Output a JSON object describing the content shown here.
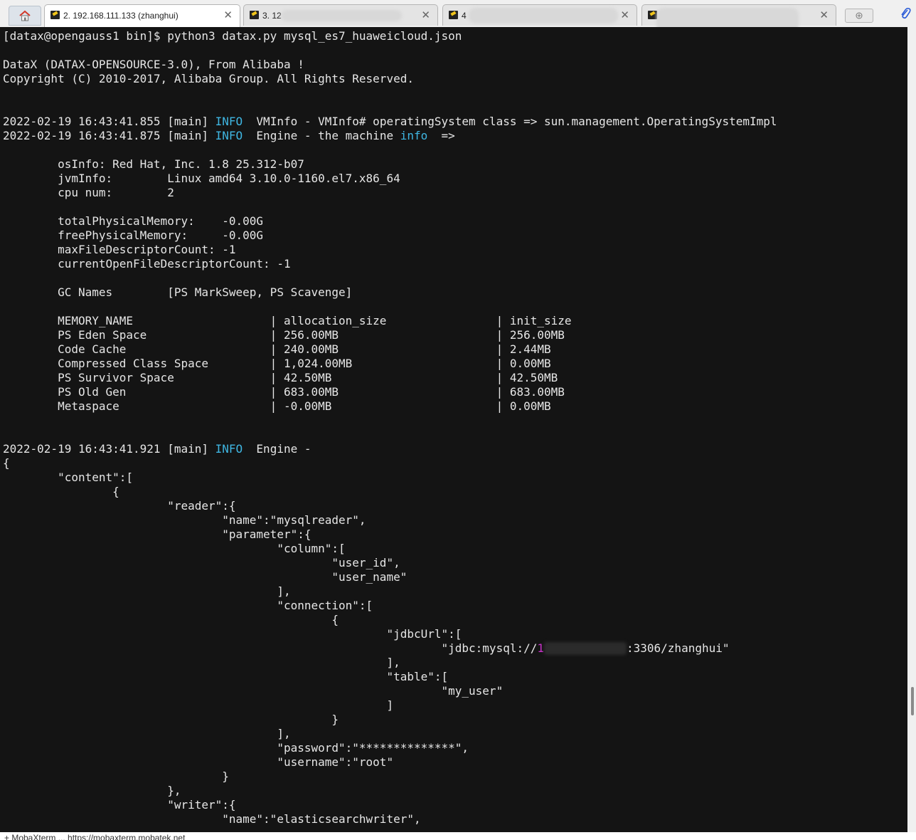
{
  "tabs": [
    {
      "label": "2. 192.168.111.133 (zhanghui)",
      "active": true
    },
    {
      "label": "3. 12",
      "active": false
    },
    {
      "label": "4",
      "active": false
    },
    {
      "label": "",
      "active": false
    }
  ],
  "terminal": {
    "lines": [
      [
        {
          "t": "[datax@opengauss1 bin]$ python3 datax.py mysql_es7_huaweicloud.json"
        }
      ],
      [],
      [
        {
          "t": "DataX (DATAX-OPENSOURCE-3.0), From Alibaba !"
        }
      ],
      [
        {
          "t": "Copyright (C) 2010-2017, Alibaba Group. All Rights Reserved."
        }
      ],
      [],
      [],
      [
        {
          "t": "2022-02-19 16:43:41.855 [main] "
        },
        {
          "t": "INFO",
          "c": "info"
        },
        {
          "t": "  VMInfo - VMInfo# operatingSystem class => sun.management.OperatingSystemImpl"
        }
      ],
      [
        {
          "t": "2022-02-19 16:43:41.875 [main] "
        },
        {
          "t": "INFO",
          "c": "info"
        },
        {
          "t": "  Engine - the machine "
        },
        {
          "t": "info",
          "c": "info"
        },
        {
          "t": "  =>"
        }
      ],
      [],
      [
        {
          "t": "        osInfo: Red Hat, Inc. 1.8 25.312-b07"
        }
      ],
      [
        {
          "t": "        jvmInfo:        Linux amd64 3.10.0-1160.el7.x86_64"
        }
      ],
      [
        {
          "t": "        cpu num:        2"
        }
      ],
      [],
      [
        {
          "t": "        totalPhysicalMemory:    -0.00G"
        }
      ],
      [
        {
          "t": "        freePhysicalMemory:     -0.00G"
        }
      ],
      [
        {
          "t": "        maxFileDescriptorCount: -1"
        }
      ],
      [
        {
          "t": "        currentOpenFileDescriptorCount: -1"
        }
      ],
      [],
      [
        {
          "t": "        GC Names        [PS MarkSweep, PS Scavenge]"
        }
      ],
      [],
      [
        {
          "t": "        MEMORY_NAME                    | allocation_size                | init_size"
        }
      ],
      [
        {
          "t": "        PS Eden Space                  | 256.00MB                       | 256.00MB"
        }
      ],
      [
        {
          "t": "        Code Cache                     | 240.00MB                       | 2.44MB"
        }
      ],
      [
        {
          "t": "        Compressed Class Space         | 1,024.00MB                     | 0.00MB"
        }
      ],
      [
        {
          "t": "        PS Survivor Space              | 42.50MB                        | 42.50MB"
        }
      ],
      [
        {
          "t": "        PS Old Gen                     | 683.00MB                       | 683.00MB"
        }
      ],
      [
        {
          "t": "        Metaspace                      | -0.00MB                        | 0.00MB"
        }
      ],
      [],
      [],
      [
        {
          "t": "2022-02-19 16:43:41.921 [main] "
        },
        {
          "t": "INFO",
          "c": "info"
        },
        {
          "t": "  Engine -"
        }
      ],
      [
        {
          "t": "{"
        }
      ],
      [
        {
          "t": "        \"content\":["
        }
      ],
      [
        {
          "t": "                {"
        }
      ],
      [
        {
          "t": "                        \"reader\":{"
        }
      ],
      [
        {
          "t": "                                \"name\":\"mysqlreader\","
        }
      ],
      [
        {
          "t": "                                \"parameter\":{"
        }
      ],
      [
        {
          "t": "                                        \"column\":["
        }
      ],
      [
        {
          "t": "                                                \"user_id\","
        }
      ],
      [
        {
          "t": "                                                \"user_name\""
        }
      ],
      [
        {
          "t": "                                        ],"
        }
      ],
      [
        {
          "t": "                                        \"connection\":["
        }
      ],
      [
        {
          "t": "                                                {"
        }
      ],
      [
        {
          "t": "                                                        \"jdbcUrl\":["
        }
      ],
      [
        {
          "t": "                                                                \"jdbc:mysql://"
        },
        {
          "t": "1",
          "c": "purple"
        },
        {
          "t": "",
          "c": "redact"
        },
        {
          "t": ":3306/zhanghui\""
        }
      ],
      [
        {
          "t": "                                                        ],"
        }
      ],
      [
        {
          "t": "                                                        \"table\":["
        }
      ],
      [
        {
          "t": "                                                                \"my_user\""
        }
      ],
      [
        {
          "t": "                                                        ]"
        }
      ],
      [
        {
          "t": "                                                }"
        }
      ],
      [
        {
          "t": "                                        ],"
        }
      ],
      [
        {
          "t": "                                        \"password\":\"**************\","
        }
      ],
      [
        {
          "t": "                                        \"username\":\"root\""
        }
      ],
      [
        {
          "t": "                                }"
        }
      ],
      [
        {
          "t": "                        },"
        }
      ],
      [
        {
          "t": "                        \"writer\":{"
        }
      ],
      [
        {
          "t": "                                \"name\":\"elasticsearchwriter\","
        }
      ]
    ]
  },
  "scroll": {
    "position": 0.85,
    "thumb_fraction": 0.035
  },
  "statusbar": {
    "text": "+ MobaXterm ... https://mobaxterm.mobatek.net"
  },
  "colors": {
    "info": "#3fb6e2",
    "purple": "#cc33cc",
    "background": "#141414",
    "foreground": "#e6e6e6"
  },
  "icons": {
    "home": "home-icon",
    "tab": "terminal-session-icon",
    "close": "close-icon",
    "new_tab": "new-tab-icon",
    "attach": "paperclip-icon"
  }
}
